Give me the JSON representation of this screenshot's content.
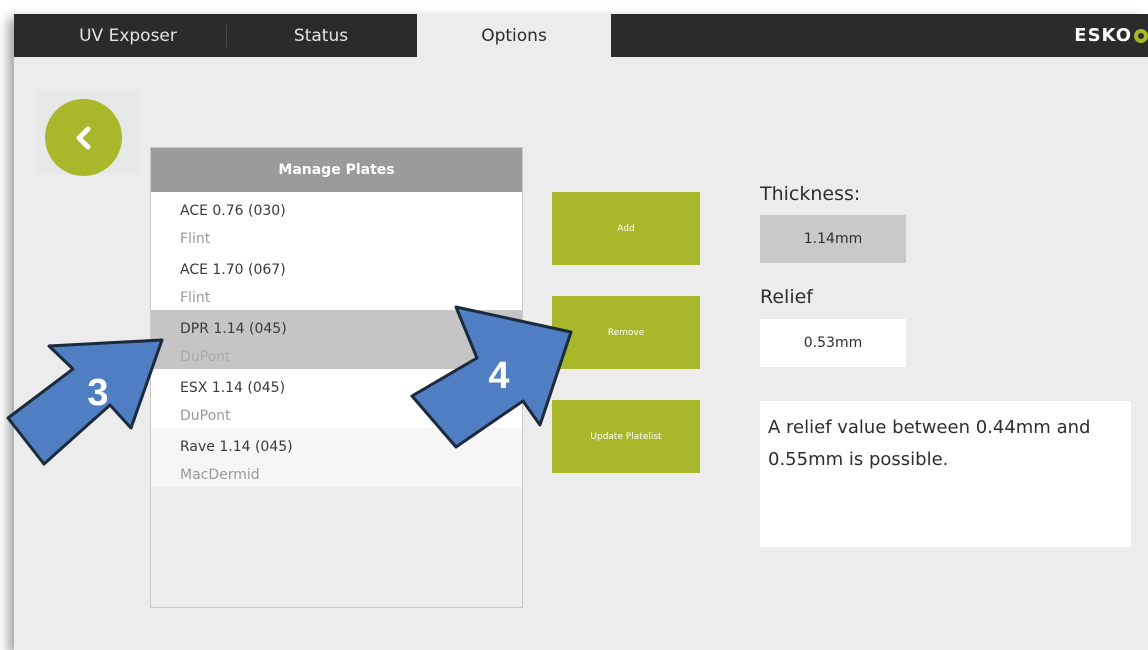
{
  "tabs": [
    {
      "label": "UV Exposer",
      "active": false
    },
    {
      "label": "Status",
      "active": false
    },
    {
      "label": "Options",
      "active": true
    }
  ],
  "brand": {
    "logo_text": "ESKO",
    "accent_color": "#a8b82a",
    "topbar_color": "#2b2b2b"
  },
  "back_button": {
    "icon": "chevron-left-icon"
  },
  "plates": {
    "title": "Manage Plates",
    "items": [
      {
        "name": "ACE 0.76 (030)",
        "maker": "Flint",
        "selected": false
      },
      {
        "name": "ACE 1.70 (067)",
        "maker": "Flint",
        "selected": false
      },
      {
        "name": "DPR 1.14 (045)",
        "maker": "DuPont",
        "selected": true
      },
      {
        "name": "ESX 1.14 (045)",
        "maker": "DuPont",
        "selected": false
      },
      {
        "name": "Rave 1.14 (045)",
        "maker": "MacDermid",
        "selected": false
      }
    ]
  },
  "actions": {
    "add": "Add",
    "remove": "Remove",
    "update": "Update Platelist"
  },
  "details": {
    "thickness_label": "Thickness:",
    "thickness_value": "1.14mm",
    "relief_label": "Relief",
    "relief_value": "0.53mm",
    "info_text": "A relief value between 0.44mm and 0.55mm is possible."
  },
  "callouts": [
    {
      "number": "3",
      "color": "#4f7fc2"
    },
    {
      "number": "4",
      "color": "#4f7fc2"
    }
  ]
}
